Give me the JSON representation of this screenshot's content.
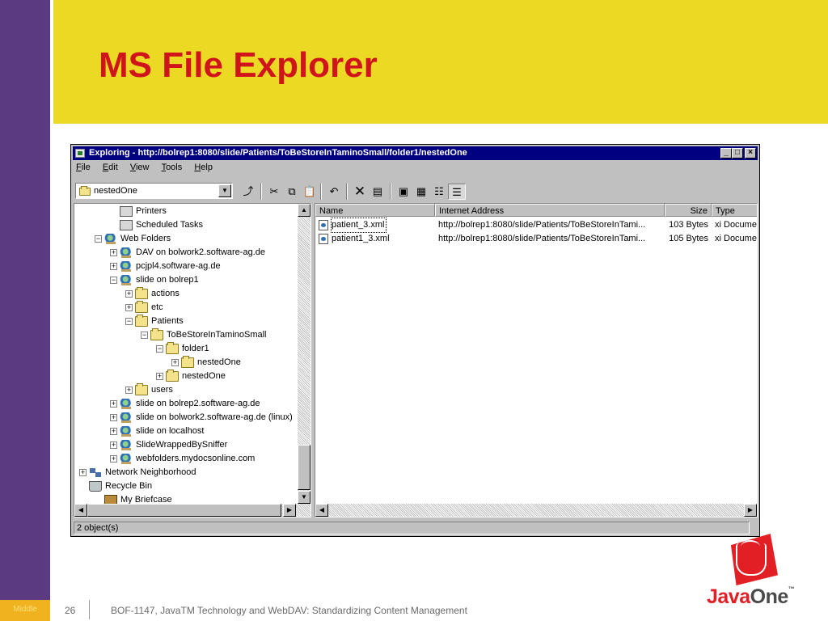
{
  "slide": {
    "title": "MS File Explorer",
    "left_label": "Middle",
    "page_number": "26",
    "footer_text": "BOF-1147, JavaTM Technology and WebDAV: Standardizing Content Management",
    "logo_brand_a": "Java",
    "logo_brand_b": "One",
    "logo_tm": "™",
    "colors": {
      "title": "#d0141b",
      "title_band": "#ecd924",
      "left_band": "#5b3a82",
      "logo": "#e31f26"
    }
  },
  "window": {
    "title": "Exploring - http://bolrep1:8080/slide/Patients/ToBeStoreInTaminoSmall/folder1/nestedOne",
    "btn_minimize": "_",
    "btn_maximize": "□",
    "btn_close": "×",
    "menu": [
      "File",
      "Edit",
      "View",
      "Tools",
      "Help"
    ],
    "address_value": "nestedOne",
    "status_text": "2 object(s)"
  },
  "tree": [
    {
      "label": "Printers",
      "icon": "printer-icon",
      "expander": ""
    },
    {
      "label": "Scheduled Tasks",
      "icon": "printer-icon",
      "expander": ""
    },
    {
      "label": "Web Folders",
      "icon": "globe-icon",
      "expander": "−"
    },
    {
      "label": "DAV on bolwork2.software-ag.de",
      "icon": "globe-icon",
      "expander": "+"
    },
    {
      "label": "pcjpl4.software-ag.de",
      "icon": "globe-icon",
      "expander": "+"
    },
    {
      "label": "slide on bolrep1",
      "icon": "globe-icon",
      "expander": "−"
    },
    {
      "label": "actions",
      "icon": "folder-icon",
      "expander": "+"
    },
    {
      "label": "etc",
      "icon": "folder-icon",
      "expander": "+"
    },
    {
      "label": "Patients",
      "icon": "folder-icon",
      "expander": "−"
    },
    {
      "label": "ToBeStoreInTaminoSmall",
      "icon": "folder-icon",
      "expander": "−"
    },
    {
      "label": "folder1",
      "icon": "folder-icon",
      "expander": "−"
    },
    {
      "label": "nestedOne",
      "icon": "folder-icon",
      "expander": "+"
    },
    {
      "label": "nestedOne",
      "icon": "folder-icon",
      "expander": "+"
    },
    {
      "label": "users",
      "icon": "folder-icon",
      "expander": "+"
    },
    {
      "label": "slide on bolrep2.software-ag.de",
      "icon": "globe-icon",
      "expander": "+"
    },
    {
      "label": "slide on bolwork2.software-ag.de (linux)",
      "icon": "globe-icon",
      "expander": "+"
    },
    {
      "label": "slide on localhost",
      "icon": "globe-icon",
      "expander": "+"
    },
    {
      "label": "SlideWrappedBySniffer",
      "icon": "globe-icon",
      "expander": "+"
    },
    {
      "label": "webfolders.mydocsonline.com",
      "icon": "globe-icon",
      "expander": "+"
    },
    {
      "label": "Network Neighborhood",
      "icon": "network-icon",
      "expander": "+"
    },
    {
      "label": "Recycle Bin",
      "icon": "recycle-bin-icon",
      "expander": ""
    },
    {
      "label": "My Briefcase",
      "icon": "briefcase-icon",
      "expander": ""
    }
  ],
  "list": {
    "columns": [
      "Name",
      "Internet Address",
      "Size",
      "Type"
    ],
    "rows": [
      {
        "name": "patient_3.xml",
        "address": "http://bolrep1:8080/slide/Patients/ToBeStoreInTami...",
        "size": "103 Bytes",
        "type": "xi Docume"
      },
      {
        "name": "patient1_3.xml",
        "address": "http://bolrep1:8080/slide/Patients/ToBeStoreInTami...",
        "size": "105 Bytes",
        "type": "xi Docume"
      }
    ]
  }
}
